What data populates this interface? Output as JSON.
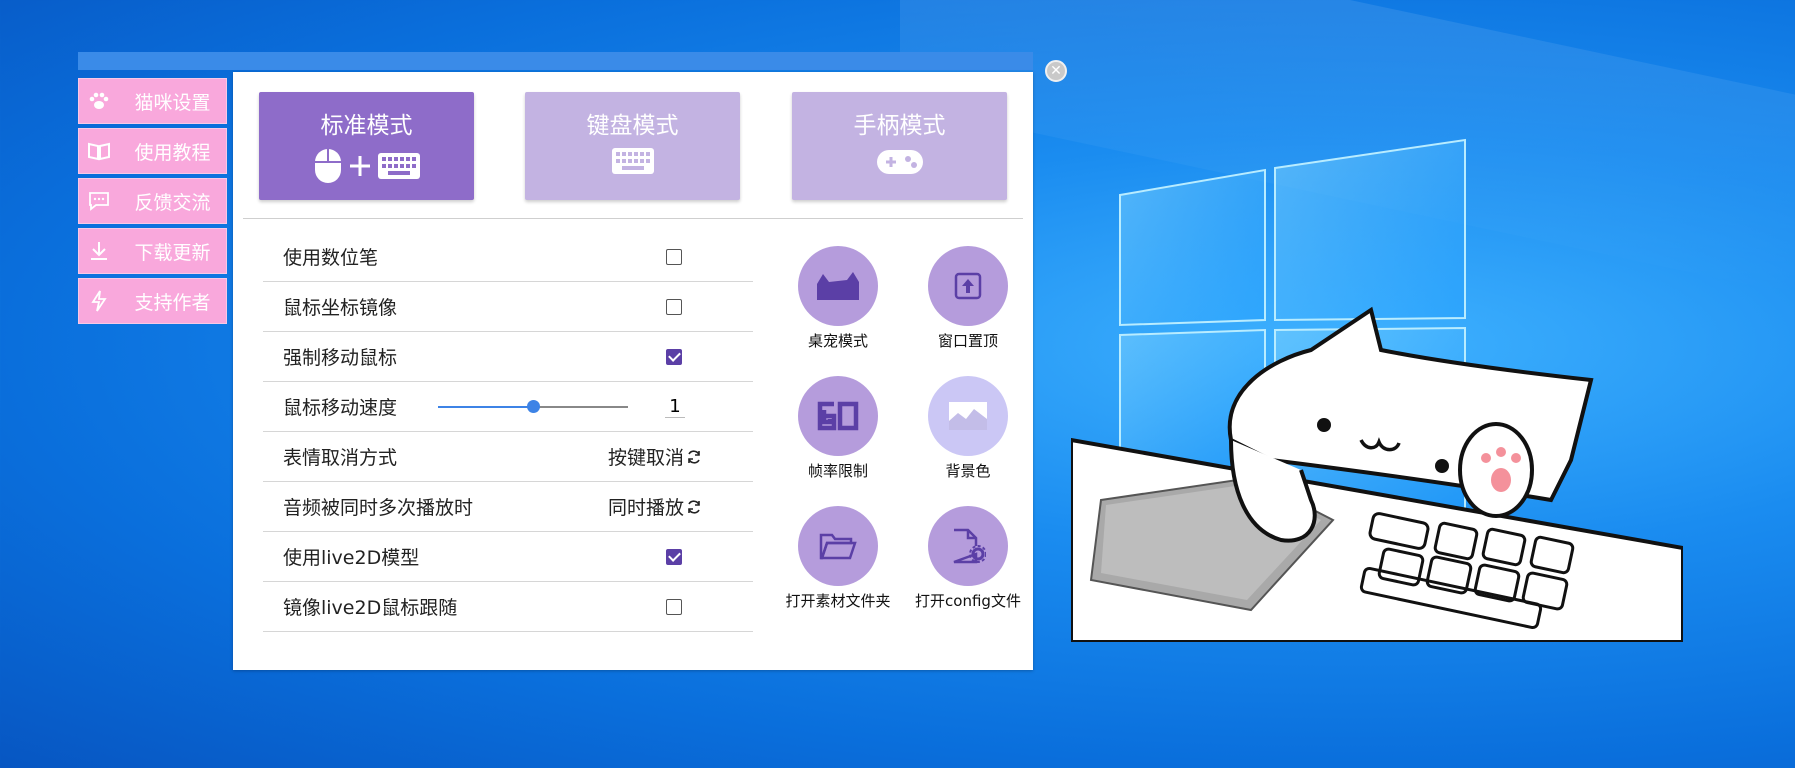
{
  "sidebar": {
    "items": [
      {
        "label": "猫咪设置",
        "icon": "paw-icon"
      },
      {
        "label": "使用教程",
        "icon": "book-icon"
      },
      {
        "label": "反馈交流",
        "icon": "chat-icon"
      },
      {
        "label": "下载更新",
        "icon": "download-icon"
      },
      {
        "label": "支持作者",
        "icon": "lightning-icon"
      }
    ]
  },
  "modes": [
    {
      "label": "标准模式",
      "active": true
    },
    {
      "label": "键盘模式",
      "active": false
    },
    {
      "label": "手柄模式",
      "active": false
    }
  ],
  "settings": [
    {
      "label": "使用数位笔",
      "type": "checkbox",
      "checked": false
    },
    {
      "label": "鼠标坐标镜像",
      "type": "checkbox",
      "checked": false
    },
    {
      "label": "强制移动鼠标",
      "type": "checkbox",
      "checked": true
    },
    {
      "label": "鼠标移动速度",
      "type": "slider",
      "value": "1",
      "fraction": 0.5
    },
    {
      "label": "表情取消方式",
      "type": "cycle",
      "value": "按键取消"
    },
    {
      "label": "音频被同时多次播放时",
      "type": "cycle",
      "value": "同时播放"
    },
    {
      "label": "使用live2D模型",
      "type": "checkbox",
      "checked": true
    },
    {
      "label": "镜像live2D鼠标跟随",
      "type": "checkbox",
      "checked": false
    }
  ],
  "tools": [
    {
      "label": "桌宠模式",
      "icon": "cat-silhouette-icon"
    },
    {
      "label": "窗口置顶",
      "icon": "pin-top-icon"
    },
    {
      "label": "帧率限制",
      "icon": "fps-60-icon"
    },
    {
      "label": "背景色",
      "icon": "background-image-icon"
    },
    {
      "label": "打开素材文件夹",
      "icon": "folder-open-icon"
    },
    {
      "label": "打开config文件",
      "icon": "config-file-icon"
    }
  ],
  "colors": {
    "accent": "#8e6cc9",
    "accent_light": "#c3b3e2",
    "sidebar": "#f9a8dc",
    "checkbox_on": "#5b3fa6",
    "slider": "#3d83e6"
  }
}
